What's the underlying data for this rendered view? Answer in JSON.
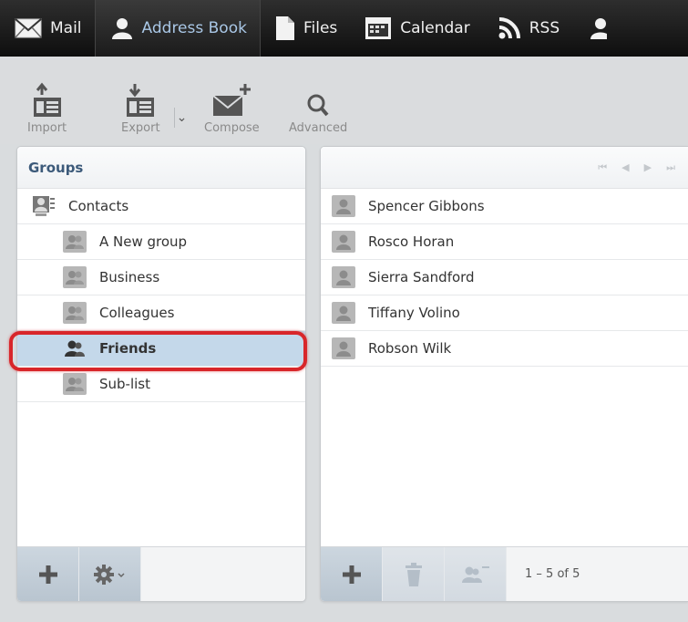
{
  "topnav": {
    "items": [
      {
        "label": "Mail",
        "icon": "mail-icon"
      },
      {
        "label": "Address Book",
        "icon": "person-icon"
      },
      {
        "label": "Files",
        "icon": "file-icon"
      },
      {
        "label": "Calendar",
        "icon": "calendar-icon"
      },
      {
        "label": "RSS",
        "icon": "rss-icon"
      }
    ],
    "active": "Address Book"
  },
  "toolbar": {
    "import_label": "Import",
    "export_label": "Export",
    "compose_label": "Compose",
    "advanced_label": "Advanced"
  },
  "groups": {
    "title": "Groups",
    "root": "Contacts",
    "items": [
      "A New group",
      "Business",
      "Colleagues",
      "Friends",
      "Sub-list"
    ],
    "selected": "Friends"
  },
  "contacts": {
    "items": [
      "Spencer Gibbons",
      "Rosco Horan",
      "Sierra Sandford",
      "Tiffany Volino",
      "Robson Wilk"
    ],
    "count_text": "1 – 5 of 5"
  },
  "colors": {
    "accent": "#a9c7e6",
    "selected_row": "#c4d8ea",
    "highlight": "#d8262a"
  }
}
